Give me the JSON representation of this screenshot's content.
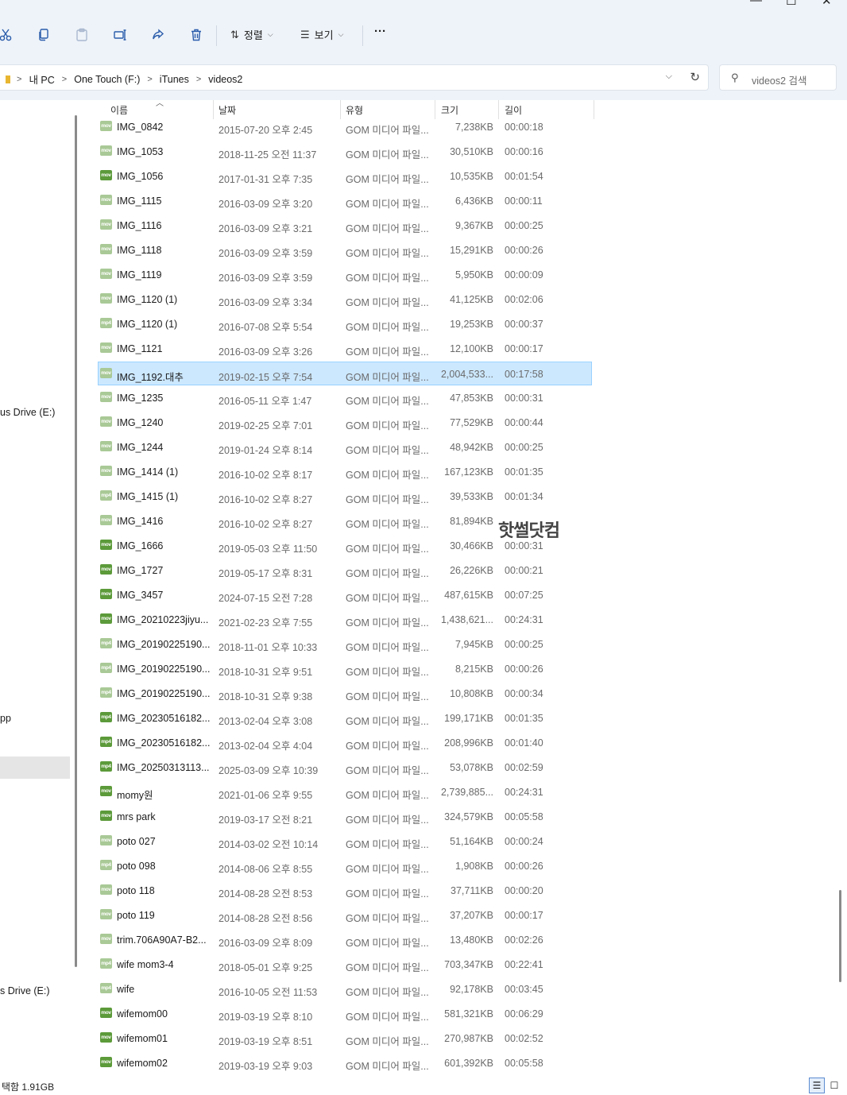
{
  "window": {
    "minimize": "—",
    "maximize": "☐",
    "close": "✕"
  },
  "toolbar": {
    "sort_label": "정렬",
    "view_label": "보기",
    "more_label": "···"
  },
  "address": {
    "crumbs": [
      "내 PC",
      "One Touch (F:)",
      "iTunes",
      "videos2"
    ],
    "search_placeholder": "videos2 검색"
  },
  "nav": {
    "items": [
      {
        "label": "us Drive (E:)"
      },
      {
        "label": "pp"
      },
      {
        "label": "s Drive (E:)"
      }
    ]
  },
  "columns": {
    "name": "이름",
    "date": "날짜",
    "type": "유형",
    "size": "크기",
    "length": "길이"
  },
  "files": [
    {
      "name": "IMG_0842",
      "date": "2015-07-20 오후 2:45",
      "type": "GOM 미디어 파일...",
      "size": "7,238KB",
      "length": "00:00:18",
      "icon": "mov",
      "shade": "light"
    },
    {
      "name": "IMG_1053",
      "date": "2018-11-25 오전 11:37",
      "type": "GOM 미디어 파일...",
      "size": "30,510KB",
      "length": "00:00:16",
      "icon": "mov",
      "shade": "light"
    },
    {
      "name": "IMG_1056",
      "date": "2017-01-31 오후 7:35",
      "type": "GOM 미디어 파일...",
      "size": "10,535KB",
      "length": "00:01:54",
      "icon": "mov",
      "shade": "dark"
    },
    {
      "name": "IMG_1115",
      "date": "2016-03-09 오후 3:20",
      "type": "GOM 미디어 파일...",
      "size": "6,436KB",
      "length": "00:00:11",
      "icon": "mov",
      "shade": "light"
    },
    {
      "name": "IMG_1116",
      "date": "2016-03-09 오후 3:21",
      "type": "GOM 미디어 파일...",
      "size": "9,367KB",
      "length": "00:00:25",
      "icon": "mov",
      "shade": "light"
    },
    {
      "name": "IMG_1118",
      "date": "2016-03-09 오후 3:59",
      "type": "GOM 미디어 파일...",
      "size": "15,291KB",
      "length": "00:00:26",
      "icon": "mov",
      "shade": "light"
    },
    {
      "name": "IMG_1119",
      "date": "2016-03-09 오후 3:59",
      "type": "GOM 미디어 파일...",
      "size": "5,950KB",
      "length": "00:00:09",
      "icon": "mov",
      "shade": "light"
    },
    {
      "name": "IMG_1120 (1)",
      "date": "2016-03-09 오후 3:34",
      "type": "GOM 미디어 파일...",
      "size": "41,125KB",
      "length": "00:02:06",
      "icon": "mov",
      "shade": "light"
    },
    {
      "name": "IMG_1120 (1)",
      "date": "2016-07-08 오후 5:54",
      "type": "GOM 미디어 파일...",
      "size": "19,253KB",
      "length": "00:00:37",
      "icon": "mp4",
      "shade": "light"
    },
    {
      "name": "IMG_1121",
      "date": "2016-03-09 오후 3:26",
      "type": "GOM 미디어 파일...",
      "size": "12,100KB",
      "length": "00:00:17",
      "icon": "mov",
      "shade": "light"
    },
    {
      "name": "IMG_1192.대추",
      "date": "2019-02-15 오후 7:54",
      "type": "GOM 미디어 파일...",
      "size": "2,004,533...",
      "length": "00:17:58",
      "icon": "mov",
      "shade": "light",
      "selected": true
    },
    {
      "name": "IMG_1235",
      "date": "2016-05-11 오후 1:47",
      "type": "GOM 미디어 파일...",
      "size": "47,853KB",
      "length": "00:00:31",
      "icon": "mov",
      "shade": "light"
    },
    {
      "name": "IMG_1240",
      "date": "2019-02-25 오후 7:01",
      "type": "GOM 미디어 파일...",
      "size": "77,529KB",
      "length": "00:00:44",
      "icon": "mov",
      "shade": "light"
    },
    {
      "name": "IMG_1244",
      "date": "2019-01-24 오후 8:14",
      "type": "GOM 미디어 파일...",
      "size": "48,942KB",
      "length": "00:00:25",
      "icon": "mov",
      "shade": "light"
    },
    {
      "name": "IMG_1414 (1)",
      "date": "2016-10-02 오후 8:17",
      "type": "GOM 미디어 파일...",
      "size": "167,123KB",
      "length": "00:01:35",
      "icon": "mov",
      "shade": "light"
    },
    {
      "name": "IMG_1415 (1)",
      "date": "2016-10-02 오후 8:27",
      "type": "GOM 미디어 파일...",
      "size": "39,533KB",
      "length": "00:01:34",
      "icon": "mp4",
      "shade": "light"
    },
    {
      "name": "IMG_1416",
      "date": "2016-10-02 오후 8:27",
      "type": "GOM 미디어 파일...",
      "size": "81,894KB",
      "length": "",
      "icon": "mov",
      "shade": "light"
    },
    {
      "name": "IMG_1666",
      "date": "2019-05-03 오후 11:50",
      "type": "GOM 미디어 파일...",
      "size": "30,466KB",
      "length": "00:00:31",
      "icon": "mov",
      "shade": "dark"
    },
    {
      "name": "IMG_1727",
      "date": "2019-05-17 오후 8:31",
      "type": "GOM 미디어 파일...",
      "size": "26,226KB",
      "length": "00:00:21",
      "icon": "mov",
      "shade": "dark"
    },
    {
      "name": "IMG_3457",
      "date": "2024-07-15 오전 7:28",
      "type": "GOM 미디어 파일...",
      "size": "487,615KB",
      "length": "00:07:25",
      "icon": "mov",
      "shade": "dark"
    },
    {
      "name": "IMG_20210223jiyu...",
      "date": "2021-02-23 오후 7:55",
      "type": "GOM 미디어 파일...",
      "size": "1,438,621...",
      "length": "00:24:31",
      "icon": "mov",
      "shade": "dark"
    },
    {
      "name": "IMG_20190225190...",
      "date": "2018-11-01 오후 10:33",
      "type": "GOM 미디어 파일...",
      "size": "7,945KB",
      "length": "00:00:25",
      "icon": "mp4",
      "shade": "light"
    },
    {
      "name": "IMG_20190225190...",
      "date": "2018-10-31 오후 9:51",
      "type": "GOM 미디어 파일...",
      "size": "8,215KB",
      "length": "00:00:26",
      "icon": "mp4",
      "shade": "light"
    },
    {
      "name": "IMG_20190225190...",
      "date": "2018-10-31 오후 9:38",
      "type": "GOM 미디어 파일...",
      "size": "10,808KB",
      "length": "00:00:34",
      "icon": "mp4",
      "shade": "light"
    },
    {
      "name": "IMG_20230516182...",
      "date": "2013-02-04 오후 3:08",
      "type": "GOM 미디어 파일...",
      "size": "199,171KB",
      "length": "00:01:35",
      "icon": "mp4",
      "shade": "dark"
    },
    {
      "name": "IMG_20230516182...",
      "date": "2013-02-04 오후 4:04",
      "type": "GOM 미디어 파일...",
      "size": "208,996KB",
      "length": "00:01:40",
      "icon": "mp4",
      "shade": "dark"
    },
    {
      "name": "IMG_20250313113...",
      "date": "2025-03-09 오후 10:39",
      "type": "GOM 미디어 파일...",
      "size": "53,078KB",
      "length": "00:02:59",
      "icon": "mp4",
      "shade": "dark"
    },
    {
      "name": "momy원",
      "date": "2021-01-06 오후 9:55",
      "type": "GOM 미디어 파일...",
      "size": "2,739,885...",
      "length": "00:24:31",
      "icon": "mov",
      "shade": "dark"
    },
    {
      "name": "mrs park",
      "date": "2019-03-17 오전 8:21",
      "type": "GOM 미디어 파일...",
      "size": "324,579KB",
      "length": "00:05:58",
      "icon": "mov",
      "shade": "dark"
    },
    {
      "name": "poto 027",
      "date": "2014-03-02 오전 10:14",
      "type": "GOM 미디어 파일...",
      "size": "51,164KB",
      "length": "00:00:24",
      "icon": "mov",
      "shade": "light"
    },
    {
      "name": "poto 098",
      "date": "2014-08-06 오후 8:55",
      "type": "GOM 미디어 파일...",
      "size": "1,908KB",
      "length": "00:00:26",
      "icon": "mp4",
      "shade": "light"
    },
    {
      "name": "poto 118",
      "date": "2014-08-28 오전 8:53",
      "type": "GOM 미디어 파일...",
      "size": "37,711KB",
      "length": "00:00:20",
      "icon": "mov",
      "shade": "light"
    },
    {
      "name": "poto 119",
      "date": "2014-08-28 오전 8:56",
      "type": "GOM 미디어 파일...",
      "size": "37,207KB",
      "length": "00:00:17",
      "icon": "mov",
      "shade": "light"
    },
    {
      "name": "trim.706A90A7-B2...",
      "date": "2016-03-09 오후 8:09",
      "type": "GOM 미디어 파일...",
      "size": "13,480KB",
      "length": "00:02:26",
      "icon": "mov",
      "shade": "light"
    },
    {
      "name": "wife mom3-4",
      "date": "2018-05-01 오후 9:25",
      "type": "GOM 미디어 파일...",
      "size": "703,347KB",
      "length": "00:22:41",
      "icon": "mp4",
      "shade": "light"
    },
    {
      "name": "wife",
      "date": "2016-10-05 오전 11:53",
      "type": "GOM 미디어 파일...",
      "size": "92,178KB",
      "length": "00:03:45",
      "icon": "mp4",
      "shade": "light"
    },
    {
      "name": "wifemom00",
      "date": "2019-03-19 오후 8:10",
      "type": "GOM 미디어 파일...",
      "size": "581,321KB",
      "length": "00:06:29",
      "icon": "mov",
      "shade": "dark"
    },
    {
      "name": "wifemom01",
      "date": "2019-03-19 오후 8:51",
      "type": "GOM 미디어 파일...",
      "size": "270,987KB",
      "length": "00:02:52",
      "icon": "mov",
      "shade": "dark"
    },
    {
      "name": "wifemom02",
      "date": "2019-03-19 오후 9:03",
      "type": "GOM 미디어 파일...",
      "size": "601,392KB",
      "length": "00:05:58",
      "icon": "mov",
      "shade": "dark"
    }
  ],
  "watermark": "핫썰닷컴",
  "status": {
    "text": "택함 1.91GB"
  },
  "colors": {
    "accent": "#2a5cab",
    "selection": "#cce8ff",
    "icon_dark": "#5c9a3a",
    "icon_light": "#a9c996"
  }
}
